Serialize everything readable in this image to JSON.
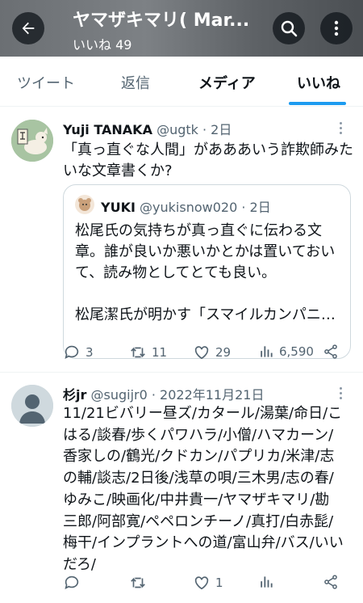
{
  "header": {
    "title": "ヤマザキマリ( Mar...",
    "subtitle": "いいね 49"
  },
  "tabs": [
    {
      "label": "ツイート"
    },
    {
      "label": "返信"
    },
    {
      "label": "メディア"
    },
    {
      "label": "いいね"
    }
  ],
  "tweets": [
    {
      "name": "Yuji TANAKA",
      "handle": "@ugtk",
      "time": "· 2日",
      "text_lines": [
        "「真っ直ぐな人間」があああいう詐欺師みた",
        "いな文章書くか?"
      ],
      "quote": {
        "name": "YUKI",
        "handle": "@yukisnow020",
        "time": "· 2日",
        "lines": [
          "松尾氏の気持ちが真っ直ぐに伝わる文",
          "章。誰が良いか悪いかとかは置いておい",
          "て、読み物としてとても良い。",
          "",
          "松尾潔氏が明かす「スマイルカンパニ…"
        ]
      },
      "actions": {
        "replies": "3",
        "retweets": "11",
        "likes": "29",
        "views": "6,590"
      }
    },
    {
      "name": "杉jr",
      "handle": "@sugijr0",
      "time": "· 2022年11月21日",
      "text_lines": [
        "11/21ビバリー昼ズ/カタール/湯葉/命日/こ",
        "はる/談春/歩くパワハラ/小僧/ハマカーン/",
        "香家しの/鶴光/クドカン/パプリカ/米津/志",
        "の輔/談志/2日後/浅草の唄/三木男/志の春/",
        "ゆみこ/映画化/中井貴一/ヤマザキマリ/勘",
        "三郎/阿部寛/ペペロンチーノ/真打/白赤髭/",
        "梅干/インプラントへの道/富山弁/バス/いい",
        "だろ/"
      ],
      "actions": {
        "replies": "",
        "retweets": "",
        "likes": "1",
        "views": ""
      }
    }
  ],
  "colors": {
    "accent": "#1d9bf0",
    "muted": "#536471",
    "text": "#0f1419"
  }
}
